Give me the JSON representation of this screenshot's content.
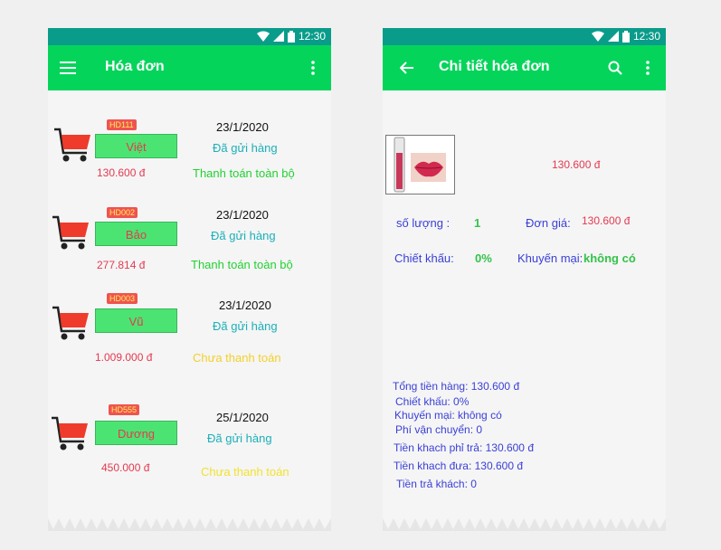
{
  "status_bar": {
    "time": "12:30"
  },
  "invoices_screen": {
    "title": "Hóa đơn",
    "invoices": [
      {
        "code": "HD111",
        "customer": "Việt",
        "total": "130.600 đ",
        "date": "23/1/2020",
        "status": "Đã gửi hàng",
        "payment": "Thanh toán toàn bộ",
        "payment_color": "#22d132"
      },
      {
        "code": "HD002",
        "customer": "Bảo",
        "total": "277.814 đ",
        "date": "23/1/2020",
        "status": "Đã gửi hàng",
        "payment": "Thanh toán toàn bộ",
        "payment_color": "#22d132"
      },
      {
        "code": "HD003",
        "customer": "Vũ",
        "total": "1.009.000 đ",
        "date": "23/1/2020",
        "status": "Đã gửi hàng",
        "payment": "Chưa thanh toán",
        "payment_color": "#f2d12b"
      },
      {
        "code": "HD555",
        "customer": "Dương",
        "total": "450.000 đ",
        "date": "25/1/2020",
        "status": "Đã gửi hàng",
        "payment": "Chưa thanh toán",
        "payment_color": "#f2e230"
      }
    ]
  },
  "detail_screen": {
    "title": "Chi tiết hóa đơn",
    "product_price": "130.600 đ",
    "quantity_label": "số lượng :",
    "quantity": "1",
    "unit_price_label": "Đơn giá:",
    "unit_price": "130.600 đ",
    "discount_label": "Chiết khấu:",
    "discount": "0%",
    "promo_label": "Khuyến mại:",
    "promo": "không có",
    "summary": {
      "subtotal": "Tổng tiền hàng: 130.600 đ",
      "discount": "Chiết khấu: 0%",
      "promo": "Khuyến mại: không có",
      "shipping": "Phí vận chuyển: 0",
      "customer_pays": "Tiền khach phỉ trả: 130.600 đ",
      "customer_gave": "Tiền khach đưa: 130.600 đ",
      "change": "Tiền trả khách: 0"
    }
  },
  "colors": {
    "status_bar": "#0a9c8a",
    "app_bar": "#05d45b",
    "price": "#e53950",
    "label": "#3a3fd6"
  }
}
